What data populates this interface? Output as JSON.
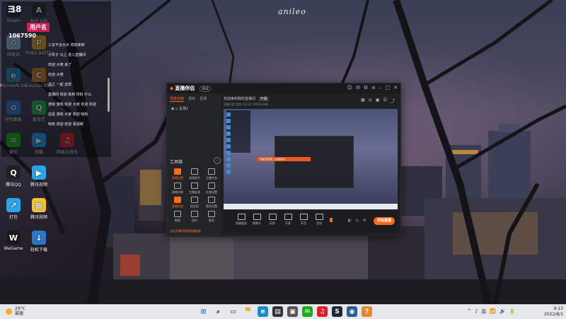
{
  "wallpaper": {
    "signature": "anileo"
  },
  "desktop_icons": [
    {
      "label": "Steam",
      "name": "steam",
      "color": "#1b2838",
      "glyph": "S"
    },
    {
      "label": "Aim Lab",
      "name": "aim-lab",
      "color": "#2a2f3a",
      "glyph": "A"
    },
    {
      "label": "回收站",
      "name": "recycle-bin",
      "color": "#8fb6d9",
      "glyph": "♻"
    },
    {
      "label": "PUBG BATTLEGR...",
      "name": "pubg",
      "color": "#d7a021",
      "glyph": "P"
    },
    {
      "label": "Microsoft Edge",
      "name": "edge",
      "color": "#1f8ac4",
      "glyph": "e"
    },
    {
      "label": "Counter-Strike Global",
      "name": "csgo",
      "color": "#c4802a",
      "glyph": "C"
    },
    {
      "label": "控制面板",
      "name": "control-panel",
      "color": "#2b7bd0",
      "glyph": "⚙"
    },
    {
      "label": "爱奇艺",
      "name": "iqiyi",
      "color": "#1fb34a",
      "glyph": "Q"
    },
    {
      "label": "微信",
      "name": "wechat",
      "color": "#1aad19",
      "glyph": "✉"
    },
    {
      "label": "优酷",
      "name": "youku",
      "color": "#1e9bf0",
      "glyph": "▶"
    },
    {
      "label": "网易云音乐",
      "name": "netease-music",
      "color": "#d4232b",
      "glyph": "♫"
    },
    {
      "label": "腾讯QQ",
      "name": "qq",
      "color": "#202020",
      "glyph": "Q"
    },
    {
      "label": "腾讯视频",
      "name": "tencent-video",
      "color": "#2aa5e8",
      "glyph": "▶"
    },
    {
      "label": "打包",
      "name": "pack",
      "color": "#2aa5e8",
      "glyph": "↗"
    },
    {
      "label": "腾讯视频",
      "name": "tencent-video-2",
      "color": "#f2c230",
      "glyph": "▦"
    },
    {
      "label": "WeGame",
      "name": "wegame",
      "color": "#1b1b1b",
      "glyph": "W"
    },
    {
      "label": "轻松下载",
      "name": "downloader",
      "color": "#2e76c8",
      "glyph": "↓"
    }
  ],
  "chat_overlay": {
    "handle": "ヨ8",
    "user_tag": "用户名",
    "user_id": "1067590",
    "lines": [
      "三言不合大大 欢迎来到",
      "小羊子 马上 进入直播间",
      "欢迎 大佬 来了",
      "欢迎 大佬",
      "总之 一起 这样",
      "直播间 欢迎 来到 你好 什么",
      "游戏 游戏 欢迎 大家 欢迎 欢迎",
      "这是 游戏 大家 欢迎 哈哈",
      "哈哈 欢迎 欢迎 看视频"
    ]
  },
  "app": {
    "logo": "直播伴侣",
    "badge": "测试",
    "side_tabs": [
      "场景切换",
      "游戏",
      "直播"
    ],
    "scene": "主场1",
    "toolbox_title": "工具箱",
    "tools": [
      {
        "label": "直播设置",
        "name": "live-settings"
      },
      {
        "label": "游戏助手",
        "name": "game-helper"
      },
      {
        "label": "主播任务",
        "name": "tasks"
      },
      {
        "label": "高能时刻",
        "name": "highlights"
      },
      {
        "label": "主播连线",
        "name": "connect"
      },
      {
        "label": "礼物设置",
        "name": "gift-settings"
      },
      {
        "label": "直播回放",
        "name": "replay"
      },
      {
        "label": "粉丝团",
        "name": "fans"
      },
      {
        "label": "更多设置",
        "name": "more-settings"
      },
      {
        "label": "数据",
        "name": "data"
      },
      {
        "label": "创作",
        "name": "create"
      },
      {
        "label": "更多",
        "name": "more"
      }
    ],
    "side_footer": "点击开播可获得直播奖励",
    "main_title": "欢迎来到我的直播间",
    "main_tag": "开播",
    "main_sub": "直播分类  游戏  CS:GO  1920x1080",
    "preview_banner": "开播已经开始，正在推流中",
    "controls": [
      {
        "label": "直播画面",
        "name": "screen"
      },
      {
        "label": "摄像头",
        "name": "camera"
      },
      {
        "label": "投屏",
        "name": "cast"
      },
      {
        "label": "开麦",
        "name": "mic"
      },
      {
        "label": "声音",
        "name": "sound"
      },
      {
        "label": "音效",
        "name": "effects"
      }
    ],
    "live_button": "开始直播"
  },
  "taskbar": {
    "weather_temp": "29°C",
    "weather_desc": "雾霾",
    "apps": [
      {
        "name": "start",
        "glyph": "⊞",
        "color": "#1c6fd1",
        "bg": "transparent"
      },
      {
        "name": "search",
        "glyph": "⌕",
        "color": "#222",
        "bg": "transparent"
      },
      {
        "name": "task-view",
        "glyph": "▭",
        "color": "#222",
        "bg": "transparent"
      },
      {
        "name": "file-explorer",
        "glyph": "▀",
        "color": "#f0b429",
        "bg": "transparent"
      },
      {
        "name": "edge",
        "glyph": "e",
        "color": "#fff",
        "bg": "#1f8ac4"
      },
      {
        "name": "store",
        "glyph": "▤",
        "color": "#fff",
        "bg": "#333"
      },
      {
        "name": "app-window",
        "glyph": "▣",
        "color": "#fff",
        "bg": "#555"
      },
      {
        "name": "wechat",
        "glyph": "✉",
        "color": "#fff",
        "bg": "#1aad19"
      },
      {
        "name": "netease-music",
        "glyph": "♫",
        "color": "#fff",
        "bg": "#d4232b"
      },
      {
        "name": "steam",
        "glyph": "S",
        "color": "#fff",
        "bg": "#1b2838"
      },
      {
        "name": "browser",
        "glyph": "◉",
        "color": "#fff",
        "bg": "#2c5e91"
      },
      {
        "name": "help",
        "glyph": "?",
        "color": "#fff",
        "bg": "#e08a2b"
      }
    ],
    "tray": [
      "^",
      "♪",
      "英",
      "📶",
      "🔊",
      "🔋"
    ],
    "time": "9:13",
    "date": "2022/8/3"
  }
}
